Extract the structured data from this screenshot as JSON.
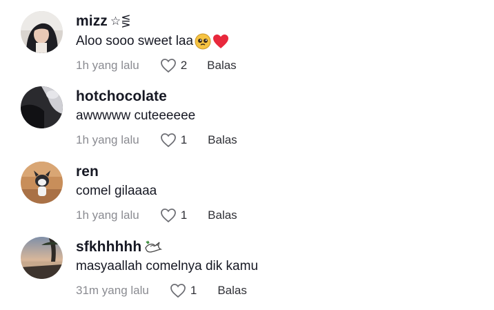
{
  "comments": [
    {
      "username": "mizz",
      "username_suffix": "☆⋚",
      "text": "Aloo sooo sweet laa",
      "time": "1h yang lalu",
      "likes": "2",
      "reply_label": "Balas",
      "emojis": [
        "pleading-face",
        "red-heart"
      ]
    },
    {
      "username": "hotchocolate",
      "text": "awwwww cuteeeeee",
      "time": "1h yang lalu",
      "likes": "1",
      "reply_label": "Balas"
    },
    {
      "username": "ren",
      "text": "comel gilaaaa",
      "time": "1h yang lalu",
      "likes": "1",
      "reply_label": "Balas"
    },
    {
      "username": "sfkhhhhh",
      "username_emoji": "dove",
      "text": "masyaallah comelnya dik kamu",
      "time": "31m yang lalu",
      "likes": "1",
      "reply_label": "Balas"
    }
  ],
  "colors": {
    "text": "#161823",
    "meta": "#8a8b91",
    "heart_emoji": "#e8283c",
    "background": "#ffffff"
  }
}
